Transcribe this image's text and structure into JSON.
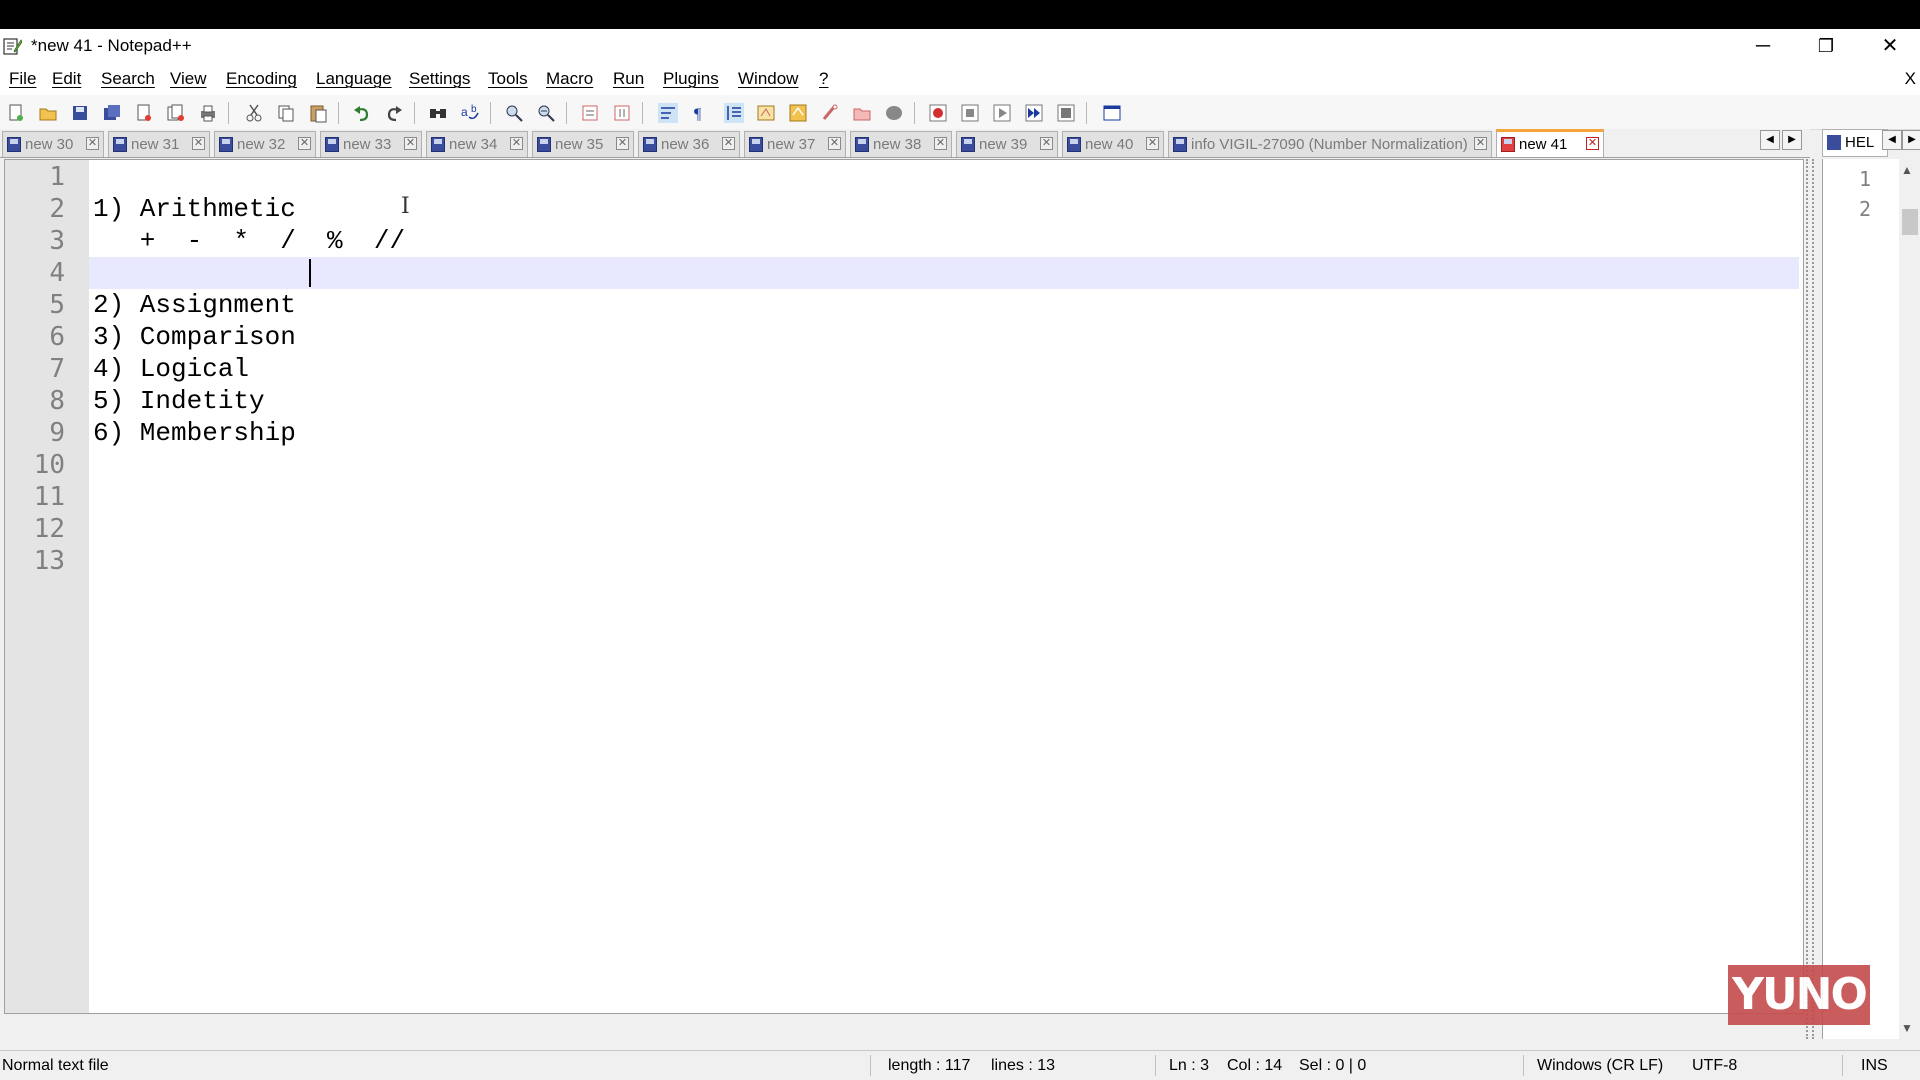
{
  "window": {
    "title": "*new 41 - Notepad++",
    "controls": {
      "minimize": "─",
      "restore": "❐",
      "close": "✕"
    }
  },
  "menu": {
    "items": [
      "File",
      "Edit",
      "Search",
      "View",
      "Encoding",
      "Language",
      "Settings",
      "Tools",
      "Macro",
      "Run",
      "Plugins",
      "Window",
      "?"
    ],
    "close_label": "X"
  },
  "tabs": [
    {
      "label": "new 30",
      "active": false
    },
    {
      "label": "new 31",
      "active": false
    },
    {
      "label": "new 32",
      "active": false
    },
    {
      "label": "new 33",
      "active": false
    },
    {
      "label": "new 34",
      "active": false
    },
    {
      "label": "new 35",
      "active": false
    },
    {
      "label": "new 36",
      "active": false
    },
    {
      "label": "new 37",
      "active": false
    },
    {
      "label": "new 38",
      "active": false
    },
    {
      "label": "new 39",
      "active": false
    },
    {
      "label": "new 40",
      "active": false
    },
    {
      "label": "info VIGIL-27090 (Number Normalization)",
      "active": false
    },
    {
      "label": "new 41",
      "active": true
    }
  ],
  "secondary_view": {
    "tab_label": "HEL",
    "line_numbers": [
      "1",
      "2"
    ]
  },
  "editor": {
    "lines": [
      "",
      "1) Arithmetic",
      "   +  -  *  /  %  //",
      "",
      "2) Assignment",
      "3) Comparison",
      "4) Logical",
      "5) Indetity",
      "6) Membership",
      "",
      "",
      "",
      ""
    ],
    "current_line": 3
  },
  "watermark": {
    "text": "YUNO"
  },
  "status": {
    "file_type": "Normal text file",
    "length": "length : 117",
    "lines": "lines : 13",
    "ln": "Ln : 3",
    "col": "Col : 14",
    "sel": "Sel : 0 | 0",
    "eol": "Windows (CR LF)",
    "encoding": "UTF-8",
    "mode": "INS"
  },
  "colors": {
    "active_tab_accent": "#f7a23a",
    "current_line_bg": "#e8e8ff",
    "gutter_bg": "#e4e4e4",
    "watermark_bg": "#c44b4b"
  }
}
